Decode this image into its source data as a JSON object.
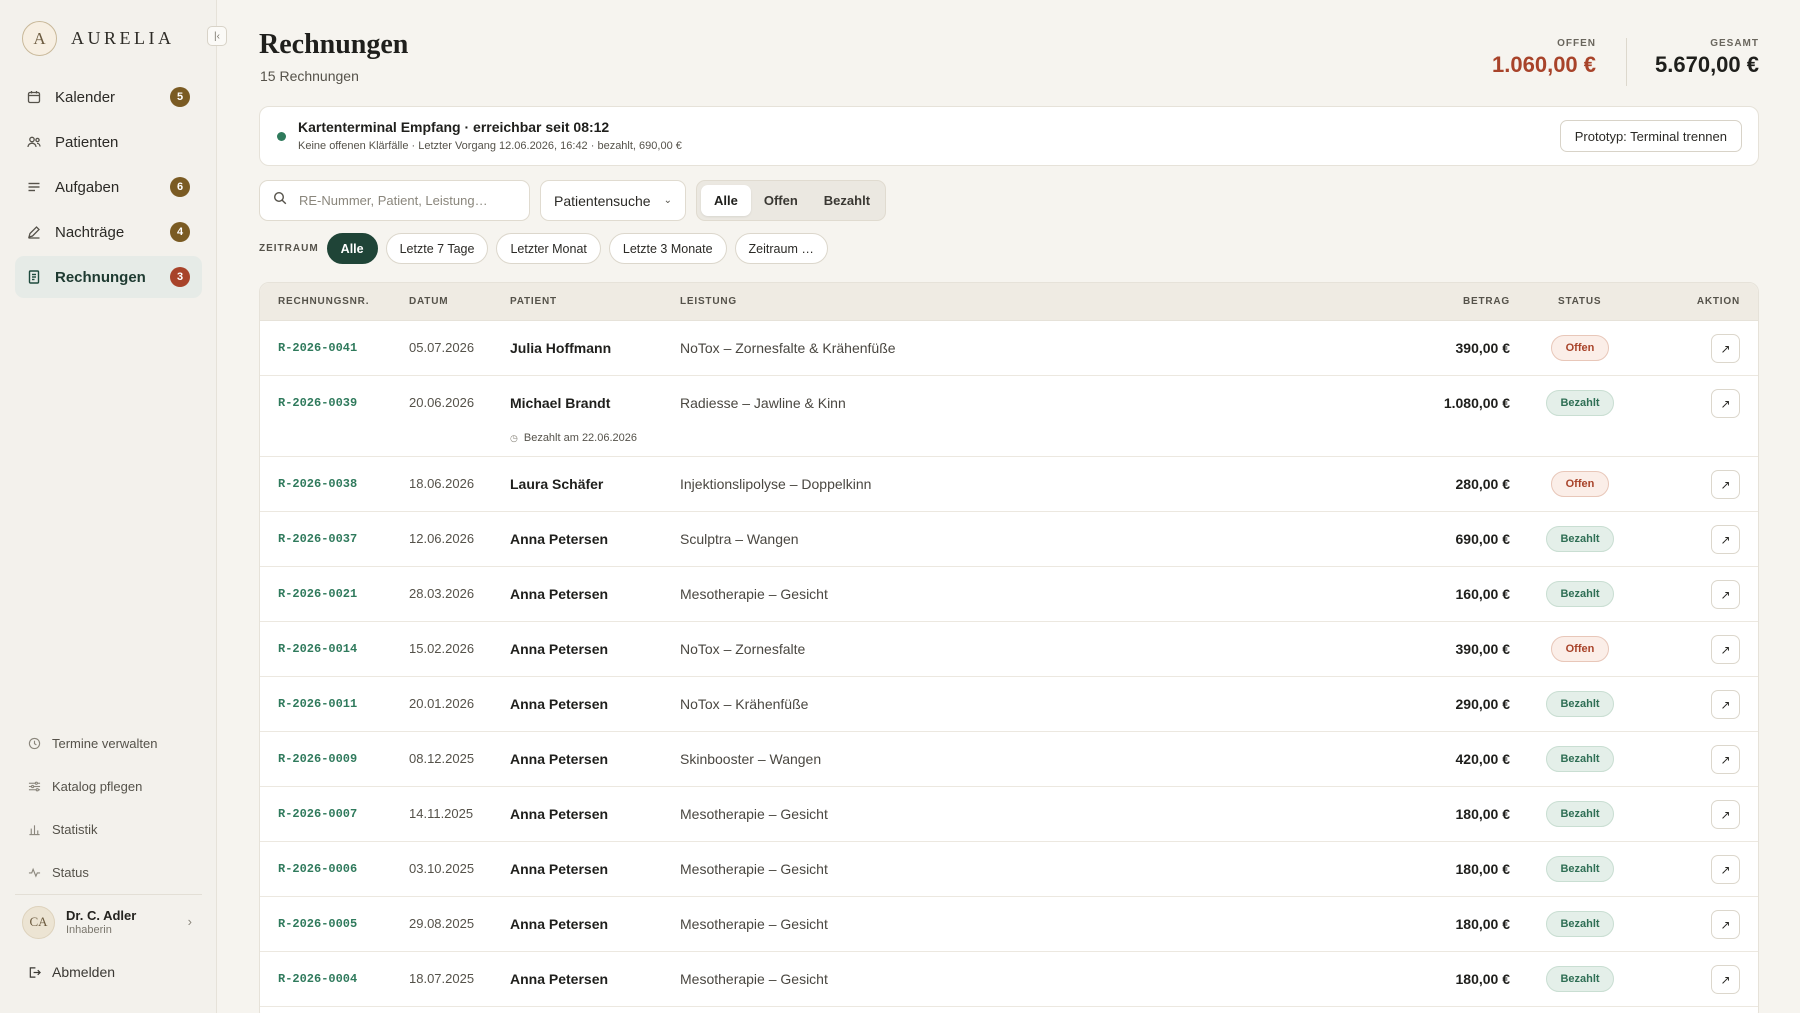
{
  "brand": {
    "mark": "A",
    "name": "AURELIA"
  },
  "nav": [
    {
      "label": "Kalender",
      "badge": "5",
      "icon": "calendar-icon",
      "active": false
    },
    {
      "label": "Patienten",
      "badge": "",
      "icon": "users-icon",
      "active": false
    },
    {
      "label": "Aufgaben",
      "badge": "6",
      "icon": "list-icon",
      "active": false
    },
    {
      "label": "Nachträge",
      "badge": "4",
      "icon": "pencil-icon",
      "active": false
    },
    {
      "label": "Rechnungen",
      "badge": "3",
      "icon": "receipt-icon",
      "active": true
    }
  ],
  "footer_nav": [
    {
      "label": "Termine verwalten",
      "icon": "clock-icon"
    },
    {
      "label": "Katalog pflegen",
      "icon": "sliders-icon"
    },
    {
      "label": "Statistik",
      "icon": "bar-chart-icon"
    },
    {
      "label": "Status",
      "icon": "pulse-icon"
    }
  ],
  "user": {
    "initials": "CA",
    "name": "Dr. C. Adler",
    "role": "Inhaberin"
  },
  "logout": "Abmelden",
  "page": {
    "title": "Rechnungen",
    "subtitle": "15 Rechnungen"
  },
  "summary": {
    "open_label": "OFFEN",
    "open_value": "1.060,00 €",
    "total_label": "GESAMT",
    "total_value": "5.670,00 €"
  },
  "terminal": {
    "title": "Kartenterminal Empfang · erreichbar seit 08:12",
    "subtitle": "Keine offenen Klärfälle · Letzter Vorgang 12.06.2026, 16:42 · bezahlt, 690,00 €",
    "button": "Prototyp: Terminal trennen",
    "status_color": "#2f7a5c"
  },
  "filters": {
    "search_placeholder": "RE-Nummer, Patient, Leistung…",
    "patient_select": "Patientensuche",
    "status_tabs": [
      "Alle",
      "Offen",
      "Bezahlt"
    ],
    "status_active": "Alle",
    "range_label": "ZEITRAUM",
    "range_chips": [
      "Alle",
      "Letzte 7 Tage",
      "Letzter Monat",
      "Letzte 3 Monate",
      "Zeitraum …"
    ],
    "range_active": "Alle"
  },
  "table": {
    "headers": {
      "nr": "RECHNUNGSNR.",
      "date": "DATUM",
      "patient": "PATIENT",
      "service": "LEISTUNG",
      "amount": "BETRAG",
      "status": "STATUS",
      "action": "AKTION"
    },
    "rows": [
      {
        "nr": "R-2026-0041",
        "date": "05.07.2026",
        "patient": "Julia Hoffmann",
        "service": "NoTox – Zornesfalte & Krähenfüße",
        "amount": "390,00 €",
        "status": "Offen",
        "note": ""
      },
      {
        "nr": "R-2026-0039",
        "date": "20.06.2026",
        "patient": "Michael Brandt",
        "service": "Radiesse – Jawline & Kinn",
        "amount": "1.080,00 €",
        "status": "Bezahlt",
        "note": "Bezahlt am 22.06.2026"
      },
      {
        "nr": "R-2026-0038",
        "date": "18.06.2026",
        "patient": "Laura Schäfer",
        "service": "Injektionslipolyse – Doppelkinn",
        "amount": "280,00 €",
        "status": "Offen",
        "note": ""
      },
      {
        "nr": "R-2026-0037",
        "date": "12.06.2026",
        "patient": "Anna Petersen",
        "service": "Sculptra – Wangen",
        "amount": "690,00 €",
        "status": "Bezahlt",
        "note": ""
      },
      {
        "nr": "R-2026-0021",
        "date": "28.03.2026",
        "patient": "Anna Petersen",
        "service": "Mesotherapie – Gesicht",
        "amount": "160,00 €",
        "status": "Bezahlt",
        "note": ""
      },
      {
        "nr": "R-2026-0014",
        "date": "15.02.2026",
        "patient": "Anna Petersen",
        "service": "NoTox – Zornesfalte",
        "amount": "390,00 €",
        "status": "Offen",
        "note": ""
      },
      {
        "nr": "R-2026-0011",
        "date": "20.01.2026",
        "patient": "Anna Petersen",
        "service": "NoTox – Krähenfüße",
        "amount": "290,00 €",
        "status": "Bezahlt",
        "note": ""
      },
      {
        "nr": "R-2026-0009",
        "date": "08.12.2025",
        "patient": "Anna Petersen",
        "service": "Skinbooster – Wangen",
        "amount": "420,00 €",
        "status": "Bezahlt",
        "note": ""
      },
      {
        "nr": "R-2026-0007",
        "date": "14.11.2025",
        "patient": "Anna Petersen",
        "service": "Mesotherapie – Gesicht",
        "amount": "180,00 €",
        "status": "Bezahlt",
        "note": ""
      },
      {
        "nr": "R-2026-0006",
        "date": "03.10.2025",
        "patient": "Anna Petersen",
        "service": "Mesotherapie – Gesicht",
        "amount": "180,00 €",
        "status": "Bezahlt",
        "note": ""
      },
      {
        "nr": "R-2026-0005",
        "date": "29.08.2025",
        "patient": "Anna Petersen",
        "service": "Mesotherapie – Gesicht",
        "amount": "180,00 €",
        "status": "Bezahlt",
        "note": ""
      },
      {
        "nr": "R-2026-0004",
        "date": "18.07.2025",
        "patient": "Anna Petersen",
        "service": "Mesotherapie – Gesicht",
        "amount": "180,00 €",
        "status": "Bezahlt",
        "note": ""
      }
    ]
  },
  "colors": {
    "accent": "#1f4437",
    "open": "#a8432a",
    "paid": "#2f6f55",
    "badge": "#7a5b23"
  }
}
